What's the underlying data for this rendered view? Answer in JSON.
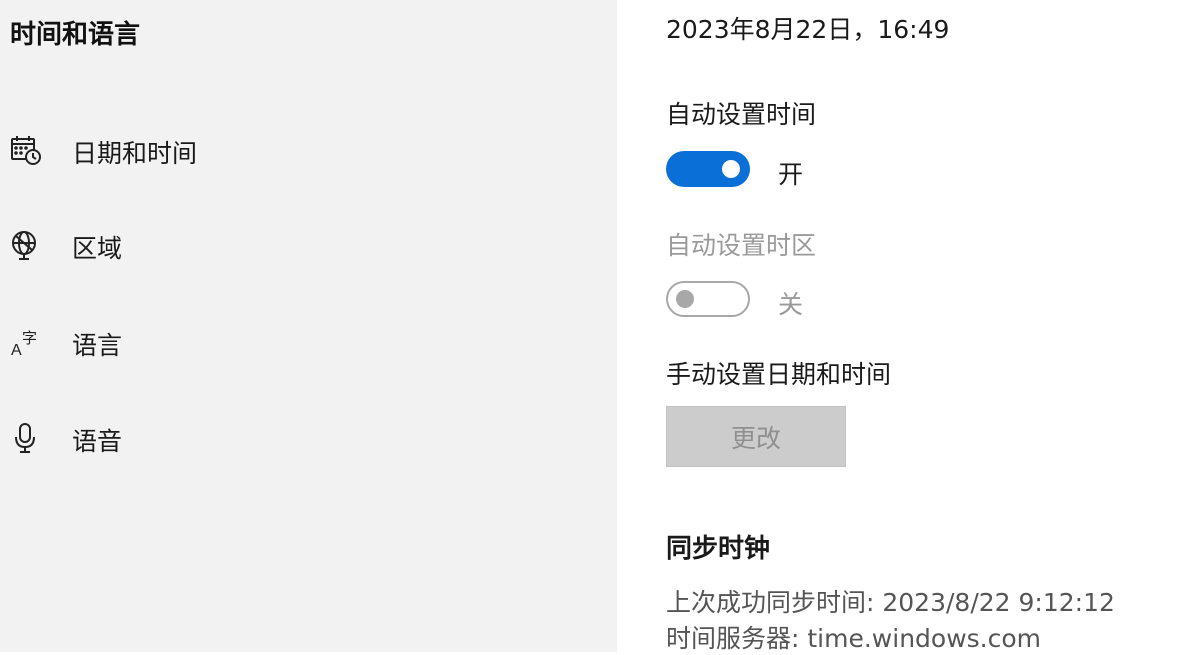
{
  "sidebar": {
    "title": "时间和语言",
    "items": [
      {
        "label": "日期和时间",
        "icon": "calendar-clock-icon"
      },
      {
        "label": "区域",
        "icon": "globe-icon"
      },
      {
        "label": "语言",
        "icon": "language-icon"
      },
      {
        "label": "语音",
        "icon": "microphone-icon"
      }
    ]
  },
  "main": {
    "current_datetime": "2023年8月22日，16:49",
    "auto_time": {
      "label": "自动设置时间",
      "state": "开",
      "on": true
    },
    "auto_timezone": {
      "label": "自动设置时区",
      "state": "关",
      "on": false
    },
    "manual": {
      "label": "手动设置日期和时间",
      "button": "更改"
    },
    "sync": {
      "heading": "同步时钟",
      "last_sync": "上次成功同步时间: 2023/8/22 9:12:12",
      "server": "时间服务器: time.windows.com"
    }
  },
  "colors": {
    "accent": "#0a6fd6",
    "sidebar_bg": "#f2f2f2",
    "disabled": "#9a9a9a"
  }
}
